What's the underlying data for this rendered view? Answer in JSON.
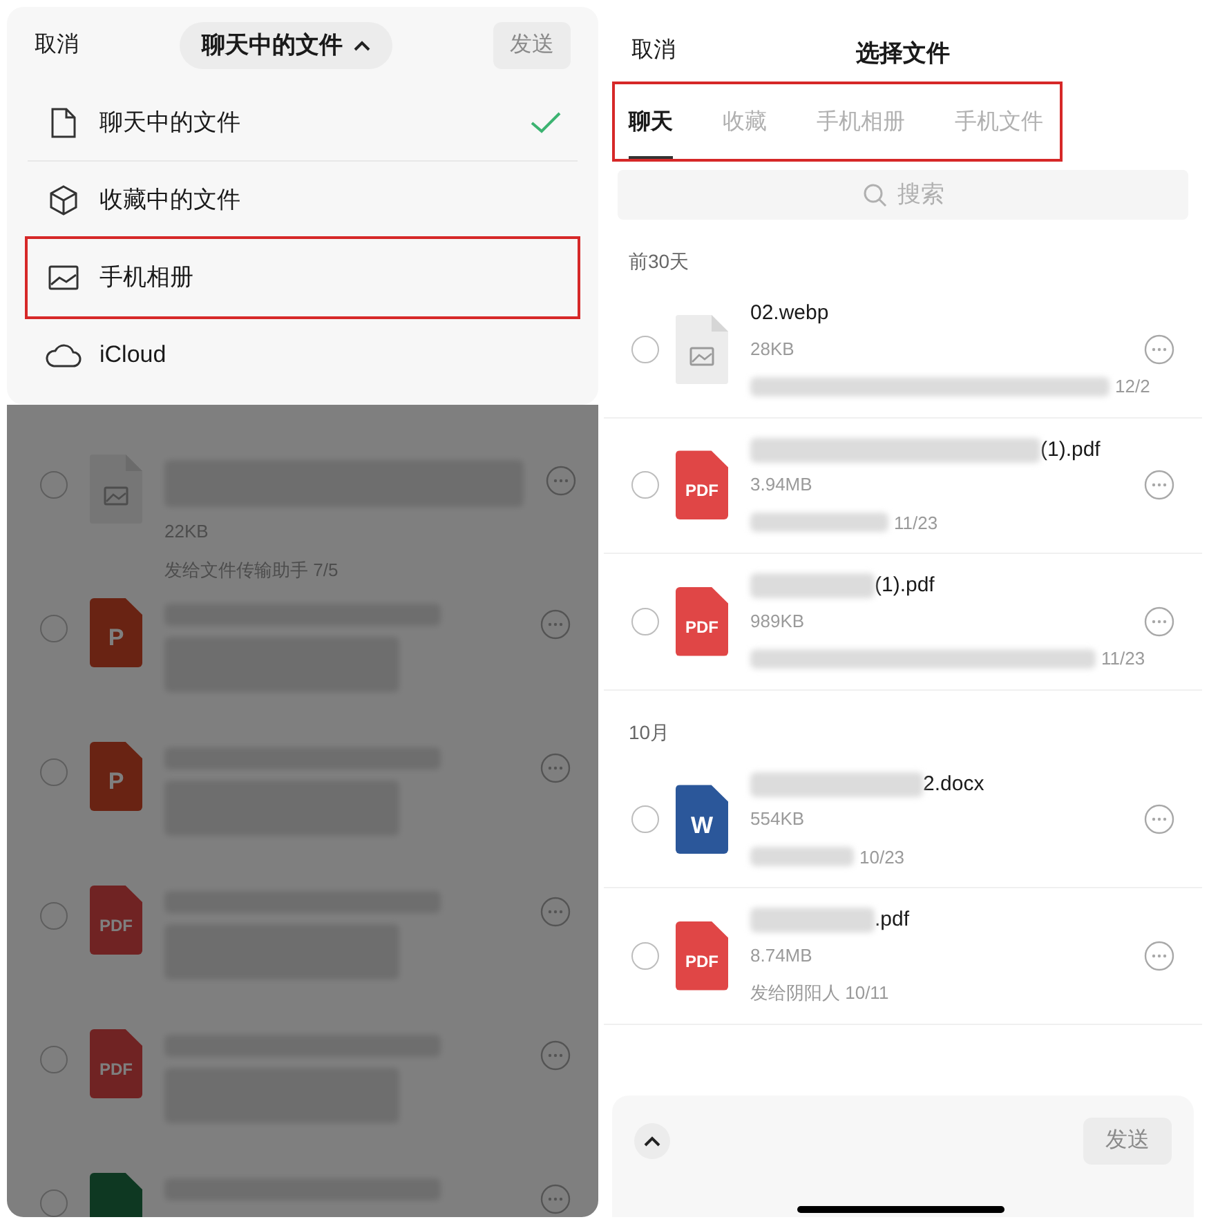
{
  "left_screen": {
    "header": {
      "cancel": "取消",
      "source_button": "聊天中的文件",
      "send": "发送"
    },
    "source_menu": [
      {
        "kind": "file",
        "label": "聊天中的文件",
        "checked": true,
        "annotated": false
      },
      {
        "kind": "cube",
        "label": "收藏中的文件",
        "checked": false,
        "annotated": false
      },
      {
        "kind": "image",
        "label": "手机相册",
        "checked": false,
        "annotated": true
      },
      {
        "kind": "cloud",
        "label": "iCloud",
        "checked": false,
        "annotated": false
      }
    ],
    "files": [
      {
        "kind": "image",
        "selected": false,
        "name_redacted": true,
        "size": "22KB",
        "meta": "发给文件传输助手 7/5",
        "meta_redacted": false
      },
      {
        "kind": "ppt",
        "badge": "P",
        "selected": false,
        "name_redacted": true,
        "meta_redacted": true
      },
      {
        "kind": "ppt",
        "badge": "P",
        "selected": false,
        "name_redacted": true,
        "meta_redacted": true
      },
      {
        "kind": "pdf",
        "badge": "PDF",
        "selected": false,
        "name_redacted": true,
        "meta_redacted": true
      },
      {
        "kind": "pdf",
        "badge": "PDF",
        "selected": false,
        "name_redacted": true,
        "meta_redacted": true
      },
      {
        "kind": "sheet",
        "selected": false,
        "name_redacted": true,
        "meta_redacted": false
      }
    ]
  },
  "right_screen": {
    "header": {
      "cancel": "取消",
      "title": "选择文件"
    },
    "tabs_annotated": true,
    "tabs": [
      {
        "label": "聊天",
        "selected": true
      },
      {
        "label": "收藏",
        "selected": false
      },
      {
        "label": "手机相册",
        "selected": false
      },
      {
        "label": "手机文件",
        "selected": false
      }
    ],
    "search": {
      "placeholder": "搜索"
    },
    "sections": [
      {
        "title": "前30天",
        "files": [
          {
            "kind": "image",
            "selected": false,
            "name": "02.webp",
            "name_redacted": false,
            "size": "28KB",
            "meta": "12/2",
            "meta_redacted": true
          },
          {
            "kind": "pdf",
            "badge": "PDF",
            "selected": false,
            "name": "(1).pdf",
            "name_redacted": true,
            "size": "3.94MB",
            "meta": "11/23",
            "meta_redacted": true
          },
          {
            "kind": "pdf",
            "badge": "PDF",
            "selected": false,
            "name": "(1).pdf",
            "name_redacted": true,
            "size": "989KB",
            "meta": "11/23",
            "meta_redacted": true
          }
        ]
      },
      {
        "title": "10月",
        "files": [
          {
            "kind": "word",
            "badge": "W",
            "selected": false,
            "name": "2.docx",
            "name_redacted": true,
            "size": "554KB",
            "meta": "10/23",
            "meta_redacted": true
          },
          {
            "kind": "pdf",
            "badge": "PDF",
            "selected": false,
            "name": ".pdf",
            "name_redacted": true,
            "size": "8.74MB",
            "meta": "发给阴阳人 10/11",
            "meta_redacted": false
          }
        ]
      }
    ],
    "send": "发送"
  }
}
